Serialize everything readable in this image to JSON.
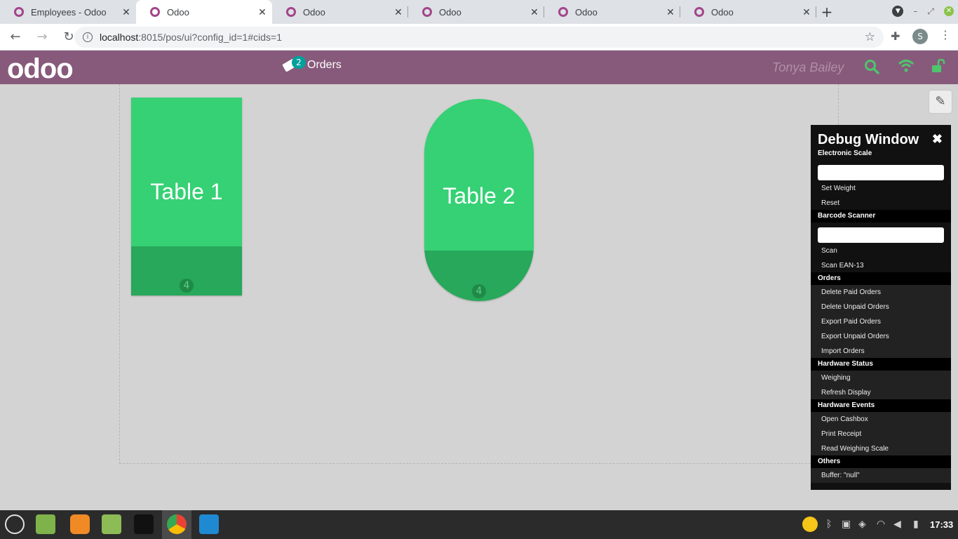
{
  "browser": {
    "tabs": [
      {
        "label": "Employees - Odoo",
        "active": false
      },
      {
        "label": "Odoo",
        "active": true
      },
      {
        "label": "Odoo",
        "active": false
      },
      {
        "label": "Odoo",
        "active": false
      },
      {
        "label": "Odoo",
        "active": false
      },
      {
        "label": "Odoo",
        "active": false
      }
    ],
    "close_glyph": "✕",
    "new_tab": "+",
    "url_host": "localhost",
    "url_rest": ":8015/pos/ui?config_id=1#cids=1",
    "profile_initial": "S"
  },
  "header": {
    "logo": "odoo",
    "orders_label": "Orders",
    "orders_count": "2",
    "cashier": "Tonya Bailey"
  },
  "tables": [
    {
      "name": "Table 1",
      "seats": "4",
      "shape": "square"
    },
    {
      "name": "Table 2",
      "seats": "4",
      "shape": "round"
    }
  ],
  "debug": {
    "title": "Debug Window",
    "close": "✖",
    "sections": {
      "electronic_scale": "Electronic Scale",
      "barcode_scanner": "Barcode Scanner",
      "orders": "Orders",
      "hardware_status": "Hardware Status",
      "hardware_events": "Hardware Events",
      "others": "Others"
    },
    "items": {
      "set_weight": "Set Weight",
      "reset": "Reset",
      "scan": "Scan",
      "scan_ean13": "Scan EAN-13",
      "delete_paid": "Delete Paid Orders",
      "delete_unpaid": "Delete Unpaid Orders",
      "export_paid": "Export Paid Orders",
      "export_unpaid": "Export Unpaid Orders",
      "import_orders": "Import Orders",
      "weighing": "Weighing",
      "refresh_display": "Refresh Display",
      "open_cashbox": "Open Cashbox",
      "print_receipt": "Print Receipt",
      "read_weighing_scale": "Read Weighing Scale",
      "buffer": "Buffer: \"null\""
    }
  },
  "taskbar": {
    "clock": "17:33"
  },
  "colors": {
    "odoo_purple": "#875a7b",
    "table_green": "#35d174",
    "table_footer_green": "#27a85a",
    "status_green": "#4ec46d"
  }
}
